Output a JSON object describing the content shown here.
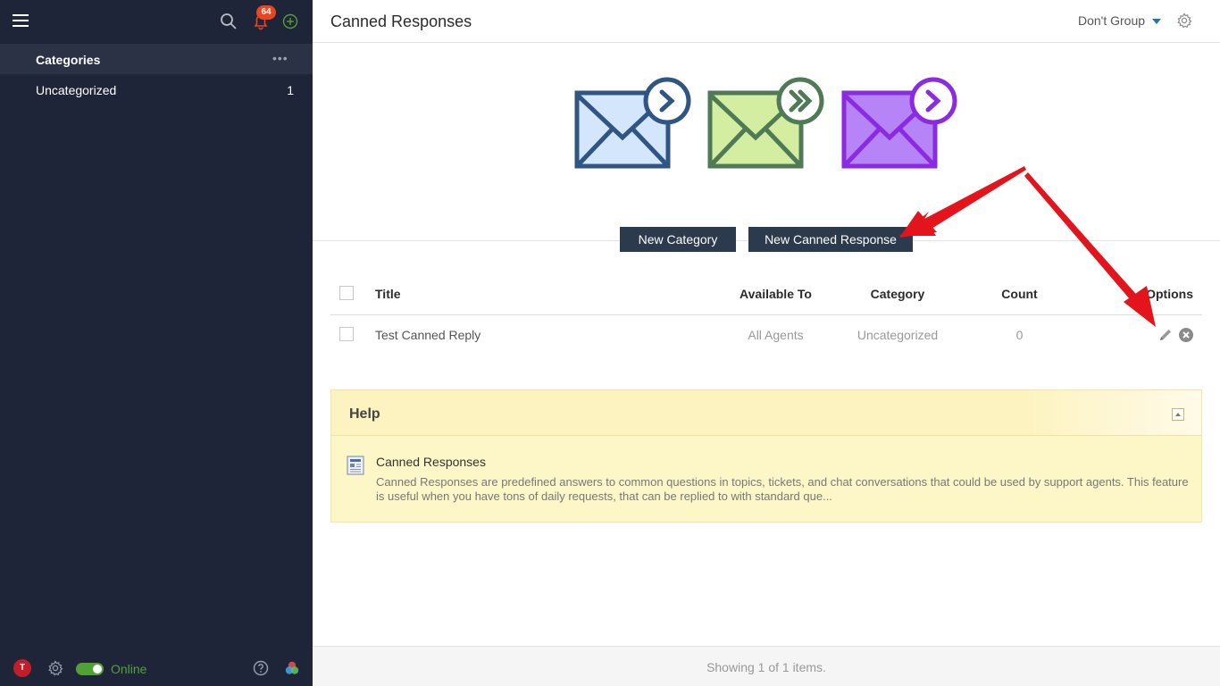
{
  "sidebar": {
    "notifications_count": "64",
    "categories_label": "Categories",
    "items": [
      {
        "label": "Uncategorized",
        "count": "1"
      }
    ],
    "user_initial": "T",
    "status_label": "Online",
    "status_color": "#52a135"
  },
  "header": {
    "title": "Canned Responses",
    "group_by_label": "Don't Group"
  },
  "actions": {
    "new_category": "New Category",
    "new_canned_response": "New Canned Response"
  },
  "table": {
    "columns": [
      "Title",
      "Available To",
      "Category",
      "Count",
      "Options"
    ],
    "rows": [
      {
        "title": "Test Canned Reply",
        "available_to": "All Agents",
        "category": "Uncategorized",
        "count": "0"
      }
    ]
  },
  "help": {
    "title": "Help",
    "article_title": "Canned Responses",
    "article_body": "Canned Responses are predefined answers to common questions in topics, tickets, and chat conversations that could be used by support agents. This feature is useful when you have tons of daily requests, that can be replied to with standard que..."
  },
  "footer": {
    "summary": "Showing 1 of 1 items."
  },
  "colors": {
    "sidebar_bg": "#1f2538",
    "button_bg": "#2b3a4d",
    "annotation_arrow": "#e3141b",
    "envelope_blue": "#2f5584",
    "envelope_green": "#4f7a55",
    "envelope_purple": "#8a2be2"
  }
}
